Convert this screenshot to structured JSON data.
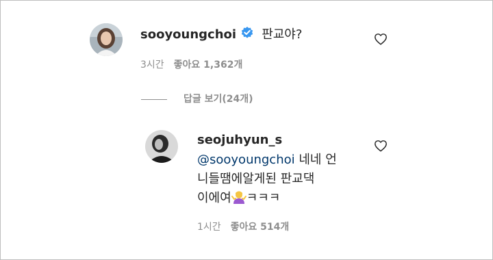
{
  "comment": {
    "username": "sooyoungchoi",
    "text": "판교야?",
    "time": "3시간",
    "likes": "좋아요 1,362개"
  },
  "replies_toggle": {
    "label": "답글 보기(24개)"
  },
  "reply": {
    "username": "seojuhyun_s",
    "mention": "@sooyoungchoi",
    "line1_rest": " 네네 언",
    "line2": "니들땜에알게된 판교댁",
    "line3_before_emoji": "이에여",
    "line3_after_emoji": "ㅋㅋㅋ",
    "time": "1시간",
    "likes": "좋아요 514개"
  },
  "icons": {
    "verified": "verified-badge-icon",
    "like": "heart-outline-icon",
    "emoji": "person-shrugging-emoji"
  },
  "colors": {
    "verified_blue": "#3897f0",
    "meta_gray": "#8e8e8e",
    "mention_blue": "#00376b"
  }
}
